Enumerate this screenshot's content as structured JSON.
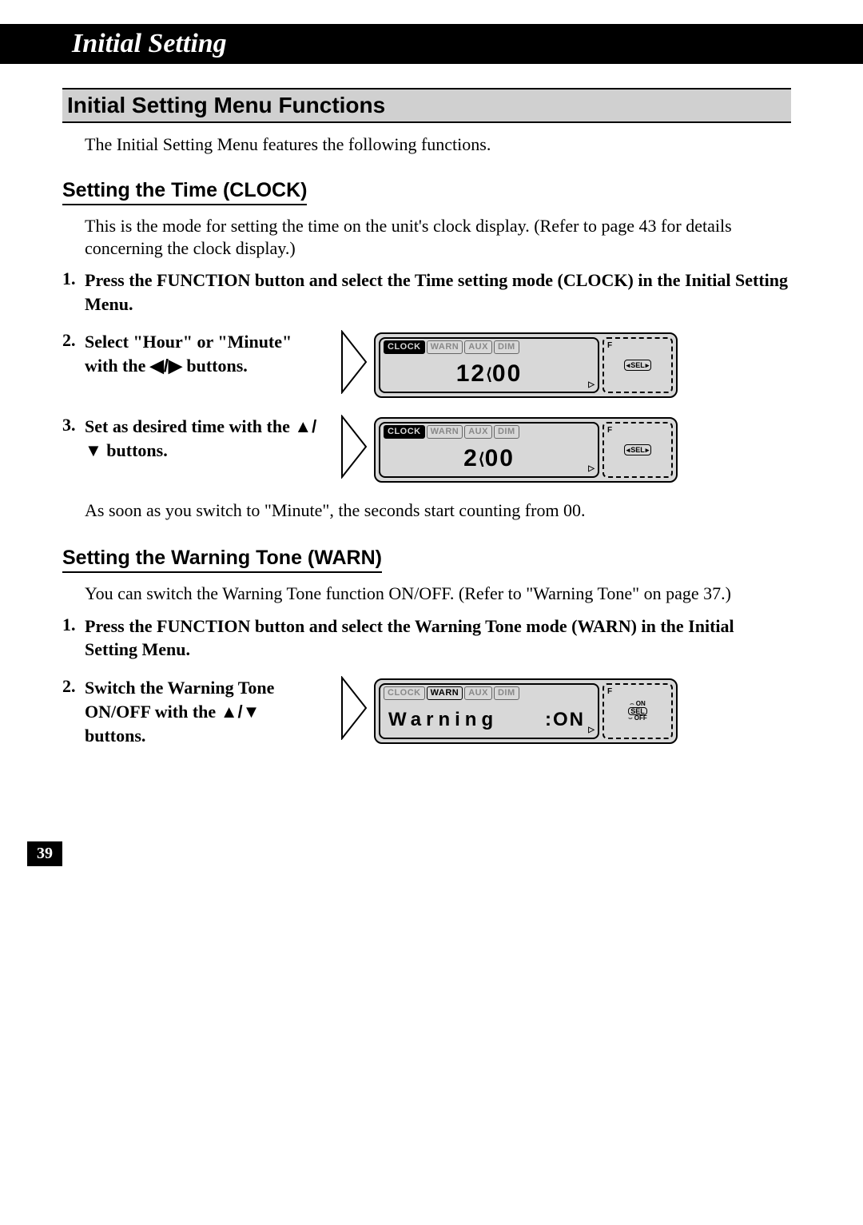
{
  "header": {
    "title": "Initial Setting"
  },
  "section": {
    "title": "Initial Setting Menu Functions",
    "intro": "The Initial Setting Menu features the following functions."
  },
  "clock": {
    "title": "Setting the Time (CLOCK)",
    "desc": "This is the mode for setting the time on the unit's clock display. (Refer to page 43 for details concerning the clock display.)",
    "step1_num": "1.",
    "step1": "Press the FUNCTION button and select the Time setting mode (CLOCK) in the Initial Setting Menu.",
    "step2_num": "2.",
    "step2_a": "Select \"Hour\" or \"Minute\" with the ",
    "step2_b": " buttons.",
    "step2_arrows": "◀/▶",
    "step3_num": "3.",
    "step3_a": "Set as desired time with the ",
    "step3_b": " buttons.",
    "step3_arrows": "▲/▼",
    "note": "As soon as you switch to \"Minute\", the seconds start counting from 00."
  },
  "warn": {
    "title": "Setting the Warning Tone (WARN)",
    "desc": "You can switch the Warning Tone function ON/OFF. (Refer to \"Warning Tone\" on page 37.)",
    "step1_num": "1.",
    "step1": "Press the FUNCTION button and select the Warning Tone mode (WARN) in the Initial Setting Menu.",
    "step2_num": "2.",
    "step2_a": "Switch the Warning Tone ON/OFF with the ",
    "step2_b": " buttons.",
    "step2_arrows": "▲/▼"
  },
  "lcd": {
    "tabs": {
      "clock": "CLOCK",
      "warn": "WARN",
      "aux": "AUX",
      "dim": "DIM"
    },
    "sel": "SEL",
    "f": "F",
    "on": "ON",
    "off": "OFF",
    "display1": {
      "hour": "12",
      "min": "00"
    },
    "display2": {
      "hour": "2",
      "min": "00"
    },
    "display3": {
      "label": "Warning",
      "value": ":ON"
    }
  },
  "page_number": "39"
}
